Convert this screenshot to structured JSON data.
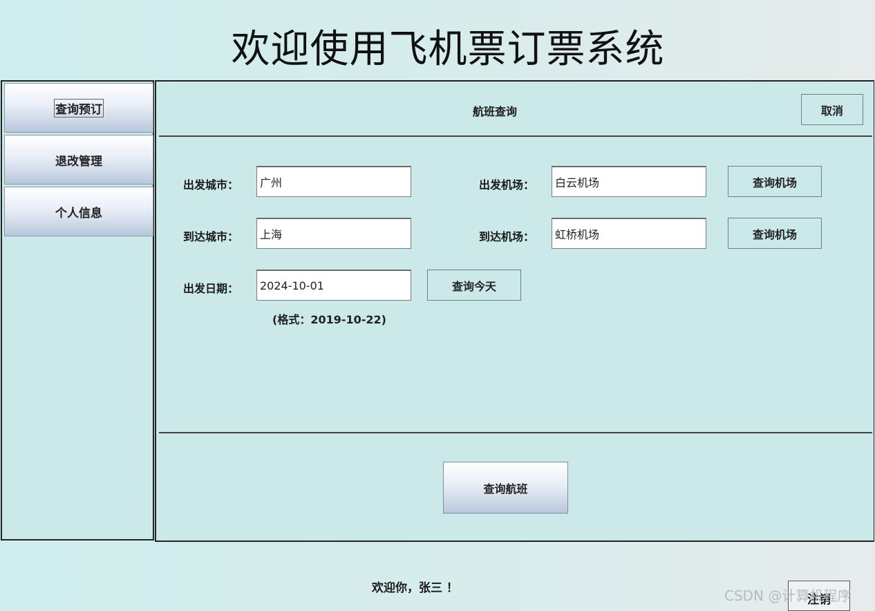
{
  "app": {
    "title": "欢迎使用飞机票订票系统"
  },
  "sidebar": {
    "items": [
      {
        "label": "查询预订"
      },
      {
        "label": "退改管理"
      },
      {
        "label": "个人信息"
      }
    ]
  },
  "main": {
    "header_title": "航班查询",
    "cancel_label": "取消",
    "form": {
      "depart_city_label": "出发城市：",
      "depart_city_value": "广州",
      "arrive_city_label": "到达城市：",
      "arrive_city_value": "上海",
      "depart_date_label": "出发日期：",
      "depart_date_value": "2024-10-01",
      "date_format_hint": "(格式：2019-10-22)",
      "depart_airport_label": "出发机场：",
      "depart_airport_value": "白云机场",
      "arrive_airport_label": "到达机场：",
      "arrive_airport_value": "虹桥机场",
      "query_airport_label": "查询机场",
      "query_today_label": "查询今天"
    },
    "search_flights_label": "查询航班"
  },
  "footer": {
    "welcome_text": "欢迎你，张三 ！",
    "logout_label": "注销",
    "watermark": "CSDN @计算机程序"
  }
}
